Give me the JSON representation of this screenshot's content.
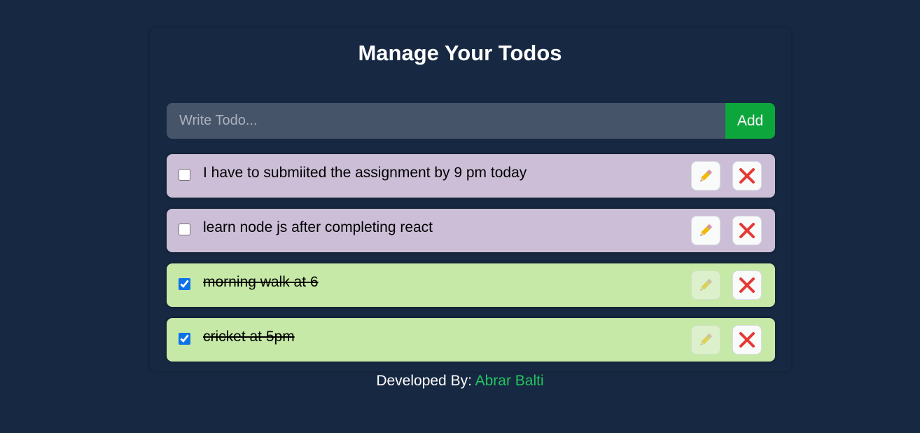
{
  "header": {
    "title": "Manage Your Todos"
  },
  "form": {
    "placeholder": "Write Todo...",
    "value": "",
    "add_label": "Add"
  },
  "colors": {
    "background": "#172842",
    "pending_row": "#ccbed7",
    "done_row": "#c6e9a7",
    "add_button": "#0da63c",
    "author": "#22c55e"
  },
  "todos": [
    {
      "text": "I have to submiited the assignment by 9 pm today",
      "completed": false,
      "edit_icon": "pencil-icon",
      "delete_icon": "cross-mark-icon"
    },
    {
      "text": "learn node js after completing react",
      "completed": false,
      "edit_icon": "pencil-icon",
      "delete_icon": "cross-mark-icon"
    },
    {
      "text": "morning walk at 6",
      "completed": true,
      "edit_icon": "pencil-icon",
      "delete_icon": "cross-mark-icon"
    },
    {
      "text": "cricket at 5pm",
      "completed": true,
      "edit_icon": "pencil-icon",
      "delete_icon": "cross-mark-icon"
    }
  ],
  "footer": {
    "prefix": "Developed By:",
    "author": "Abrar Balti"
  }
}
